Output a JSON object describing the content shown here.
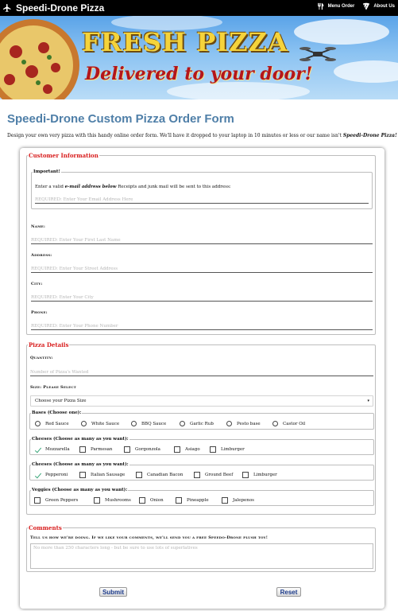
{
  "header": {
    "brand": "Speedi-Drone Pizza",
    "nav": [
      {
        "label": "Menu Order",
        "icon": "utensils-icon"
      },
      {
        "label": "About Us",
        "icon": "pizza-slice-icon"
      }
    ]
  },
  "banner": {
    "title": "FRESH PIZZA",
    "subtitle": "Delivered to your door!"
  },
  "page": {
    "title": "Speedi-Drone Custom Pizza Order Form",
    "intro": "Design your own very pizza with this handy online order form. We'll have it dropped to your laptop in 10 minutes or less or our name isn't",
    "intro_emphasis": "Speedi-Drone Pizza!"
  },
  "customer": {
    "legend": "Customer Information",
    "important_legend": "Important!",
    "important_text_pre": "Enter a valid",
    "important_text_em": "e-mail address below",
    "important_text_post": "Receipts and junk mail will be sent to this address:",
    "email_placeholder": "REQUIRED: Enter Your Email Address Here",
    "name_label": "Name:",
    "name_placeholder": "REQUIRED: Enter Your First Last Name",
    "address_label": "Address:",
    "address_placeholder": "REQUIRED: Enter Your Street Address",
    "city_label": "City:",
    "city_placeholder": "REQUIRED: Enter Your City",
    "phone_label": "Phone:",
    "phone_placeholder": "REQUIRED: Enter Your Phone Number"
  },
  "pizza": {
    "legend": "Pizza Details",
    "quantity_label": "Quantity:",
    "quantity_placeholder": "Number of Pizza's Wanted",
    "size_label": "Size: Please Select",
    "size_value": "Choose your Pizza Size",
    "bases_legend": "Bases (Choose one):",
    "bases": [
      "Red Sauce",
      "White Sauce",
      "BBQ Sauce",
      "Garlic Rub",
      "Pesto base",
      "Castor Oil"
    ],
    "cheeses_legend": "Cheeses (Choose as many as you want):",
    "cheeses": [
      {
        "label": "Mozzarella",
        "checked": true
      },
      {
        "label": "Parmesan",
        "checked": false
      },
      {
        "label": "Gorgonzola",
        "checked": false
      },
      {
        "label": "Asiago",
        "checked": false
      },
      {
        "label": "Limburger",
        "checked": false
      }
    ],
    "meats_legend": "Cheeses (Choose as many as you want):",
    "meats": [
      {
        "label": "Pepperoni",
        "checked": true
      },
      {
        "label": "Italian Sausage",
        "checked": false
      },
      {
        "label": "Canadian Bacon",
        "checked": false
      },
      {
        "label": "Ground Beef",
        "checked": false
      },
      {
        "label": "Limburger",
        "checked": false
      }
    ],
    "veggies_legend": "Veggies (Choose as many as you want):",
    "veggies": [
      {
        "label": "Green Peppers",
        "checked": false
      },
      {
        "label": "Mushrooms",
        "checked": false
      },
      {
        "label": "Onion",
        "checked": false
      },
      {
        "label": "Pineapple",
        "checked": false
      },
      {
        "label": "Jalepenos",
        "checked": false
      }
    ]
  },
  "comments": {
    "legend": "Comments",
    "prompt": "Tell us how we're doing. If we like your comments, we'll send you a free Speedo-Drone plush toy!",
    "placeholder": "No more than 250 characters long - but be sure to use lots of superlatives"
  },
  "buttons": {
    "submit": "Submit",
    "reset": "Reset"
  },
  "colors": {
    "title_blue": "#4f7fa8",
    "legend_red": "#d81d1d",
    "button_text": "#1b3a8a",
    "check_green": "#3aa77a"
  }
}
